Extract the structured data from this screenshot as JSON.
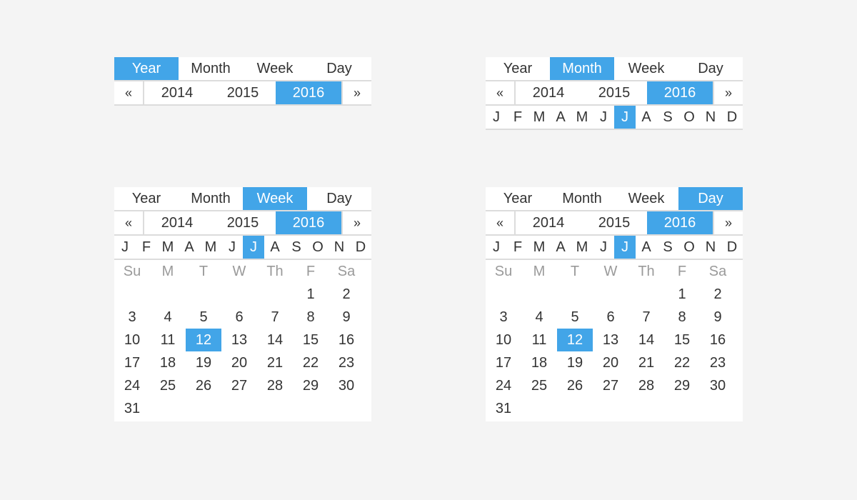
{
  "colors": {
    "background": "#f4f4f4",
    "panel": "#ffffff",
    "accent": "#42a5e8",
    "text": "#333333",
    "muted": "#9a9a9a",
    "divider": "#dcdcdc"
  },
  "views": [
    "Year",
    "Month",
    "Week",
    "Day"
  ],
  "nav": {
    "prev": "«",
    "next": "»"
  },
  "years": [
    "2014",
    "2015",
    "2016"
  ],
  "months": [
    "J",
    "F",
    "M",
    "A",
    "M",
    "J",
    "J",
    "A",
    "S",
    "O",
    "N",
    "D"
  ],
  "weekdays": [
    "Su",
    "M",
    "T",
    "W",
    "Th",
    "F",
    "Sa"
  ],
  "weeks": [
    [
      "",
      "",
      "",
      "",
      "",
      "1",
      "2"
    ],
    [
      "3",
      "4",
      "5",
      "6",
      "7",
      "8",
      "9"
    ],
    [
      "10",
      "11",
      "12",
      "13",
      "14",
      "15",
      "16"
    ],
    [
      "17",
      "18",
      "19",
      "20",
      "21",
      "22",
      "23"
    ],
    [
      "24",
      "25",
      "26",
      "27",
      "28",
      "29",
      "30"
    ],
    [
      "31",
      "",
      "",
      "",
      "",
      "",
      ""
    ]
  ],
  "selection": {
    "year": "2016",
    "month_index": 6,
    "day": "12"
  },
  "pickers": [
    {
      "id": "year",
      "active_view": "Year"
    },
    {
      "id": "month",
      "active_view": "Month"
    },
    {
      "id": "week",
      "active_view": "Week"
    },
    {
      "id": "day",
      "active_view": "Day"
    }
  ]
}
